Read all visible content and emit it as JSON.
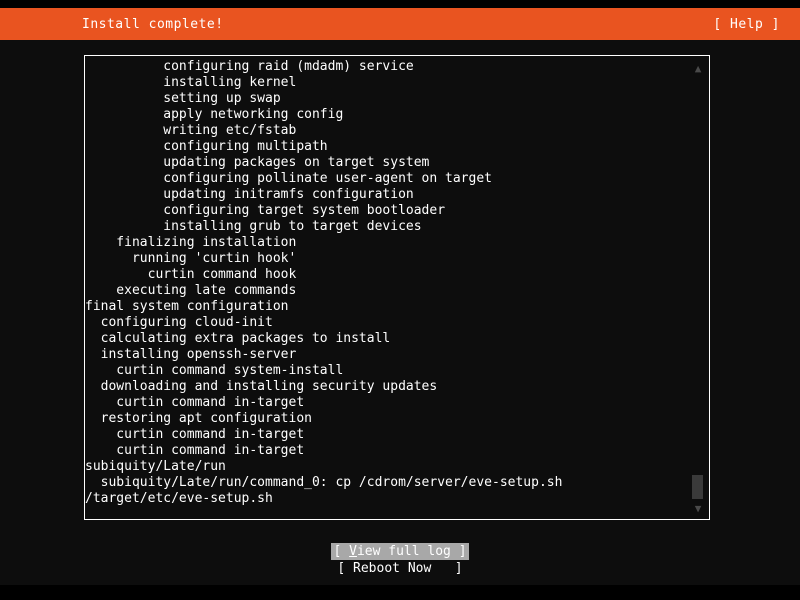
{
  "window": {
    "title": "Install complete!",
    "help_label": "[ Help ]",
    "accent_color": "#e95420",
    "background_color": "#0d0d0d",
    "text_color": "#ffffff"
  },
  "log": {
    "lines": [
      "          configuring raid (mdadm) service",
      "          installing kernel",
      "          setting up swap",
      "          apply networking config",
      "          writing etc/fstab",
      "          configuring multipath",
      "          updating packages on target system",
      "          configuring pollinate user-agent on target",
      "          updating initramfs configuration",
      "          configuring target system bootloader",
      "          installing grub to target devices",
      "    finalizing installation",
      "      running 'curtin hook'",
      "        curtin command hook",
      "    executing late commands",
      "final system configuration",
      "  configuring cloud-init",
      "  calculating extra packages to install",
      "  installing openssh-server",
      "    curtin command system-install",
      "  downloading and installing security updates",
      "    curtin command in-target",
      "  restoring apt configuration",
      "    curtin command in-target",
      "    curtin command in-target",
      "subiquity/Late/run",
      "  subiquity/Late/run/command_0: cp /cdrom/server/eve-setup.sh",
      "/target/etc/eve-setup.sh"
    ]
  },
  "scrollbar": {
    "up_arrow": "▲",
    "down_arrow": "▼"
  },
  "buttons": {
    "view_full_log": {
      "open_bracket": "[ ",
      "accel": "V",
      "rest": "iew full log",
      "close_bracket": " ]",
      "selected": true
    },
    "reboot_now": {
      "label": "[ Reboot Now   ]",
      "selected": false
    }
  }
}
